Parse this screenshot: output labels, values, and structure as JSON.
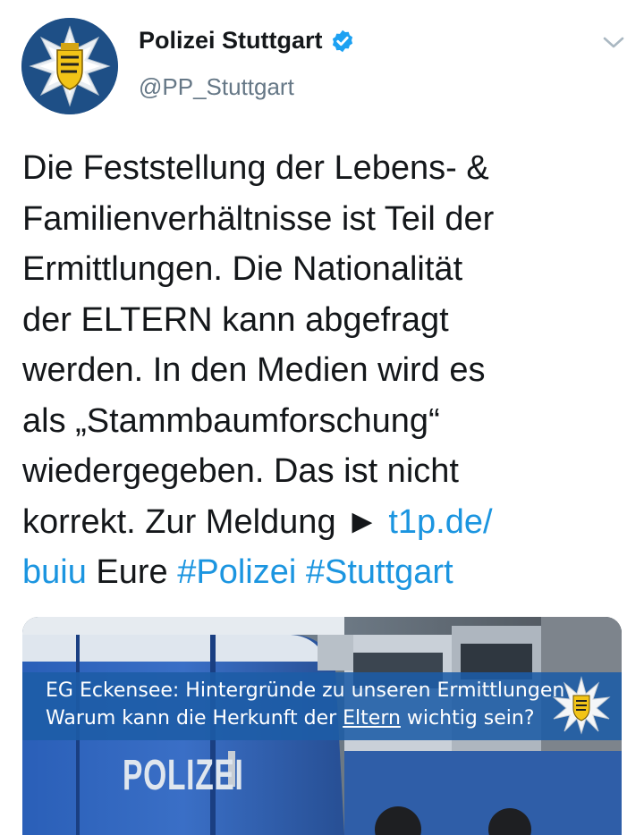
{
  "header": {
    "display_name": "Polizei Stuttgart",
    "handle": "@PP_Stuttgart",
    "verified": true
  },
  "tweet": {
    "text_before_link": "Die Feststellung der Lebens- &\nFamilienverhältnisse ist Teil der\nErmittlungen. Die Nationalität\nder ELTERN kann abgefragt\nwerden. In den Medien wird es\nals „Stammbaumforschung“\nwiedergegeben. Das ist nicht\nkorrekt. Zur Meldung ► ",
    "link_text": "t1p.de/\nbuiu",
    "text_between": " Eure ",
    "hashtag_1": "#Polizei",
    "hashtag_2": "#Stuttgart"
  },
  "media": {
    "banner_line1": "EG Eckensee: Hintergründe zu unseren Ermittlungen",
    "banner_line2_before": "Warum kann die Herkunft der ",
    "banner_line2_underlined": "Eltern",
    "banner_line2_after": " wichtig sein?",
    "vehicle_text": "POLIZEI"
  },
  "colors": {
    "link": "#1b95e0",
    "verified": "#1da1f2",
    "banner": "#1c5ca6"
  },
  "icons": {
    "verified": "verified-badge-icon",
    "menu": "chevron-down-icon",
    "avatar": "police-star-logo"
  }
}
